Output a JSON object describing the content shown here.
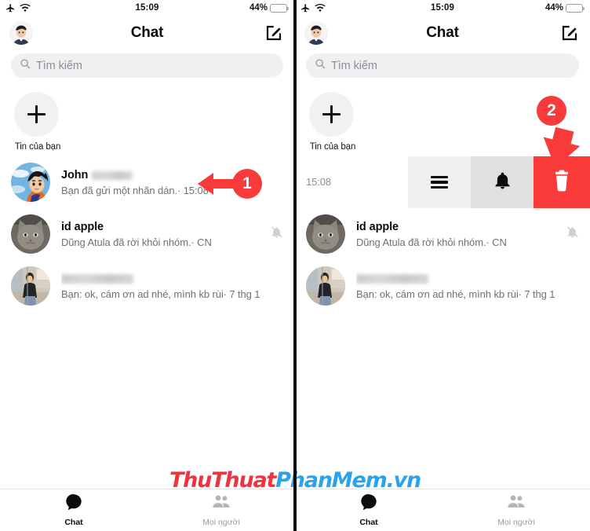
{
  "meta": {
    "app": "Messenger",
    "accent_red": "#f93a3a",
    "delete_red": "#fb3a3a",
    "watermark_red": "#ef3340",
    "watermark_blue": "#2aa3e8"
  },
  "status_bar": {
    "time": "15:09",
    "battery_percent": "44%",
    "battery_level": 44,
    "airplane_icon": "airplane-icon",
    "wifi_icon": "wifi-icon"
  },
  "nav": {
    "title": "Chat",
    "avatar_icon": "profile-avatar",
    "compose_icon": "compose-icon"
  },
  "search": {
    "placeholder": "Tìm kiếm",
    "icon": "search-icon"
  },
  "stories": {
    "add_label": "Tin của bạn",
    "add_icon": "plus-icon"
  },
  "left_panel": {
    "rows": [
      {
        "name": "John",
        "name_redacted": true,
        "snippet": "Bạn đã gửi một nhãn dán.· 15:08",
        "avatar": "anime-avatar",
        "muted": false
      },
      {
        "name": "id apple",
        "name_redacted": false,
        "snippet": "Dũng Atula đã rời khỏi nhóm.· CN",
        "avatar": "cat-avatar",
        "muted": true
      },
      {
        "name": "",
        "name_redacted": true,
        "snippet": "Bạn: ok, cám ơn ad nhé, mình kb rùi· 7 thg 1",
        "avatar": "woman-avatar",
        "muted": false
      }
    ]
  },
  "right_panel": {
    "swiped_row": {
      "time": "15:08",
      "actions": [
        {
          "label": "menu",
          "icon": "hamburger-menu-icon",
          "bg": "#f0f0f1"
        },
        {
          "label": "notifications",
          "icon": "bell-icon",
          "bg": "#e0e0e1"
        },
        {
          "label": "delete",
          "icon": "trash-icon",
          "bg": "#fb3a3a"
        }
      ]
    },
    "rows": [
      {
        "name": "id apple",
        "name_redacted": false,
        "snippet": "Dũng Atula đã rời khỏi nhóm.· CN",
        "avatar": "cat-avatar",
        "muted": true
      },
      {
        "name": "",
        "name_redacted": true,
        "snippet": "Bạn: ok, cám ơn ad nhé, mình kb rùi· 7 thg 1",
        "avatar": "woman-avatar",
        "muted": false
      }
    ]
  },
  "annotations": [
    {
      "number": "1",
      "direction": "left",
      "target": "chat-row-john"
    },
    {
      "number": "2",
      "direction": "down-right",
      "target": "delete-button"
    }
  ],
  "watermark": {
    "part_red_1": "ThuThuat",
    "part_blue": "PhanMem",
    "part_red_2": ".vn"
  },
  "tabbar": {
    "tabs": [
      {
        "label": "Chat",
        "icon": "chat-bubble-icon",
        "active": true
      },
      {
        "label": "Mọi người",
        "icon": "people-icon",
        "active": false
      }
    ]
  }
}
